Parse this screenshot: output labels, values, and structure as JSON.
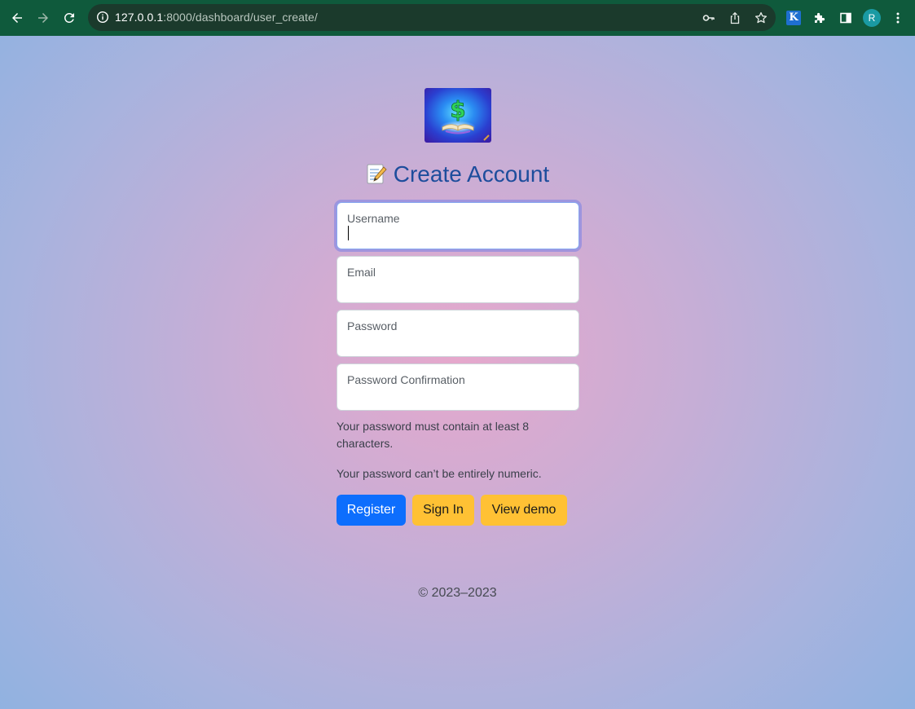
{
  "browser": {
    "url_host": "127.0.0.1",
    "url_path": ":8000/dashboard/user_create/",
    "extension_label": "K",
    "profile_initial": "R",
    "icons": {
      "back": "arrow-left-icon",
      "forward": "arrow-right-icon",
      "reload": "reload-icon",
      "site_info": "info-icon",
      "password_key": "key-icon",
      "share": "share-icon",
      "bookmark": "star-icon",
      "extensions": "puzzle-icon",
      "side_panel": "side-panel-icon",
      "menu": "kebab-menu-icon"
    }
  },
  "page": {
    "logo_icon": "dollar-book-logo",
    "title_emoji_icon": "memo-icon",
    "title": "Create Account",
    "fields": [
      {
        "label": "Username",
        "value": ""
      },
      {
        "label": "Email",
        "value": ""
      },
      {
        "label": "Password",
        "value": ""
      },
      {
        "label": "Password Confirmation",
        "value": ""
      }
    ],
    "help_texts": [
      "Your password must contain at least 8 characters.",
      "Your password can’t be entirely numeric."
    ],
    "buttons": {
      "register": "Register",
      "sign_in": "Sign In",
      "view_demo": "View demo"
    },
    "footer": "© 2023–2023"
  },
  "colors": {
    "chrome_bg": "#0f5a3c",
    "title": "#1d4d9c",
    "primary_button": "#0d6efd",
    "warning_button": "#ffc134"
  }
}
